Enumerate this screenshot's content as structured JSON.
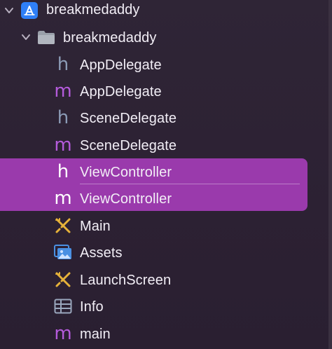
{
  "navigator": {
    "project": {
      "label": "breakmedaddy",
      "icon": "xcode-project-icon",
      "expanded": true
    },
    "group": {
      "label": "breakmedaddy",
      "icon": "folder-icon",
      "expanded": true
    },
    "items": [
      {
        "label": "AppDelegate",
        "glyph": "h",
        "kind": "header-file",
        "selected": false
      },
      {
        "label": "AppDelegate",
        "glyph": "m",
        "kind": "objc-implementation-file",
        "selected": false
      },
      {
        "label": "SceneDelegate",
        "glyph": "h",
        "kind": "header-file",
        "selected": false
      },
      {
        "label": "SceneDelegate",
        "glyph": "m",
        "kind": "objc-implementation-file",
        "selected": false
      },
      {
        "label": "ViewController",
        "glyph": "h",
        "kind": "header-file",
        "selected": true
      },
      {
        "label": "ViewController",
        "glyph": "m",
        "kind": "objc-implementation-file",
        "selected": true
      },
      {
        "label": "Main",
        "icon": "storyboard-icon",
        "kind": "storyboard",
        "selected": false
      },
      {
        "label": "Assets",
        "icon": "asset-catalog-icon",
        "kind": "asset-catalog",
        "selected": false
      },
      {
        "label": "LaunchScreen",
        "icon": "storyboard-icon",
        "kind": "storyboard",
        "selected": false
      },
      {
        "label": "Info",
        "icon": "plist-icon",
        "kind": "property-list",
        "selected": false
      },
      {
        "label": "main",
        "glyph": "m",
        "kind": "objc-implementation-file",
        "selected": false
      }
    ]
  },
  "colors": {
    "background": "#2c2133",
    "selection": "#9a3aac",
    "header_glyph": "#8b9bb6",
    "implementation_glyph": "#b55bdc",
    "project_icon": "#2f7ff7",
    "folder_icon": "#9aa0aa",
    "storyboard_icon": "#e6b23a",
    "asset_icon": "#4a90e2",
    "plist_icon": "#9aa7bd"
  }
}
